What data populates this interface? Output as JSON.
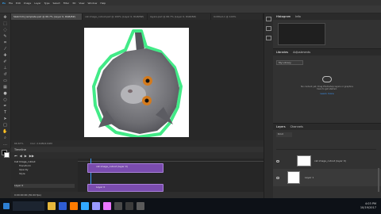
{
  "menubar": [
    "Ps",
    "File",
    "Edit",
    "Image",
    "Layer",
    "Type",
    "Select",
    "Filter",
    "3D",
    "View",
    "Window",
    "Help"
  ],
  "tabs": [
    "Sketch24_template.psd @ 66.7% (Layer 0, RGB/8#)",
    "cat image_cutout.psd @ 100% (Layer 0, RGB/8#)",
    "layers.psd @ 66.7% (Layer 0, RGB/8#)",
    "Untitled-1 @ 100%"
  ],
  "status": {
    "zoom": "66.67%",
    "doc": "Doc: 2.64M/2.64M"
  },
  "histogram": {
    "tabs": [
      "Histogram",
      "Info"
    ]
  },
  "libraries": {
    "tabs": [
      "Libraries",
      "Adjustments"
    ],
    "dropdown": "My Library",
    "message": "No content yet. Drag Photoshop layers or graphics here to get started.",
    "link": "Learn more"
  },
  "layers": {
    "tabs": [
      "Layers",
      "Channels"
    ],
    "kind": "Kind",
    "rows": [
      {
        "name": "cat image_cutout (layer 0)"
      },
      {
        "name": "Layer 1"
      }
    ]
  },
  "timeline": {
    "title": "Timeline",
    "time": "0:00:00:00 (30.00 fps)",
    "tracks": [
      "Cat Image_cutout",
      "Transform",
      "Opacity",
      "Style",
      "Layer 0"
    ],
    "clips": [
      "cat image_cutout (layer 0)",
      "Layer 0"
    ]
  },
  "taskbar": {
    "clock": "4:03 PM",
    "date": "10/19/2017"
  },
  "colors": {
    "purple": "#7a4cae",
    "glow": "#2ee87a"
  }
}
